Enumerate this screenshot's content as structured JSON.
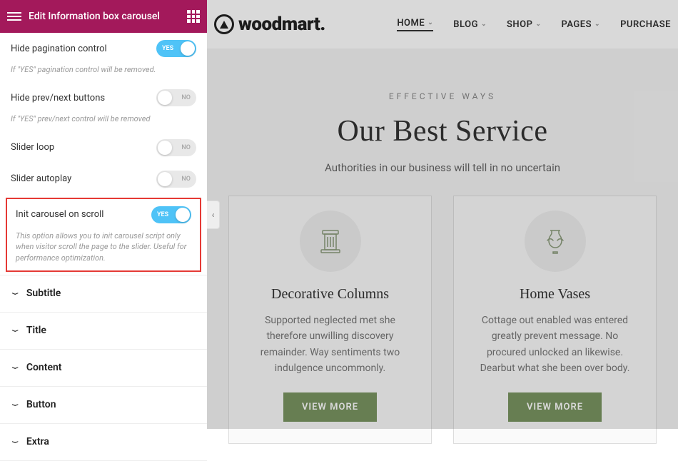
{
  "sidebar": {
    "title": "Edit Information box carousel",
    "options": {
      "hide_pagination": {
        "label": "Hide pagination control",
        "value": true,
        "state_label": "YES",
        "desc": "If \"YES\" pagination control will be removed."
      },
      "hide_prevnext": {
        "label": "Hide prev/next buttons",
        "value": false,
        "state_label": "NO",
        "desc": "If \"YES\" prev/next control will be removed"
      },
      "slider_loop": {
        "label": "Slider loop",
        "value": false,
        "state_label": "NO"
      },
      "slider_autoplay": {
        "label": "Slider autoplay",
        "value": false,
        "state_label": "NO"
      },
      "init_on_scroll": {
        "label": "Init carousel on scroll",
        "value": true,
        "state_label": "YES",
        "desc": "This option allows you to init carousel script only when visitor scroll the page to the slider. Useful for performance optimization."
      }
    },
    "accordion": [
      "Subtitle",
      "Title",
      "Content",
      "Button",
      "Extra"
    ]
  },
  "collapse_glyph": "‹",
  "nav": {
    "logo_text": "woodmart.",
    "items": [
      {
        "label": "HOME",
        "active": true
      },
      {
        "label": "BLOG"
      },
      {
        "label": "SHOP"
      },
      {
        "label": "PAGES"
      },
      {
        "label": "PURCHASE"
      }
    ]
  },
  "hero": {
    "subtitle": "EFFECTIVE WAYS",
    "title": "Our Best Service",
    "desc": "Authorities in our business will tell in no uncertain"
  },
  "cards": [
    {
      "icon": "column-icon",
      "title": "Decorative Columns",
      "desc": "Supported neglected met she therefore unwilling discovery remainder. Way sentiments two indulgence uncommonly.",
      "button": "VIEW MORE"
    },
    {
      "icon": "vase-icon",
      "title": "Home Vases",
      "desc": "Cottage out enabled was entered greatly prevent message. No procured unlocked an likewise. Dearbut what she been over body.",
      "button": "VIEW MORE"
    }
  ]
}
